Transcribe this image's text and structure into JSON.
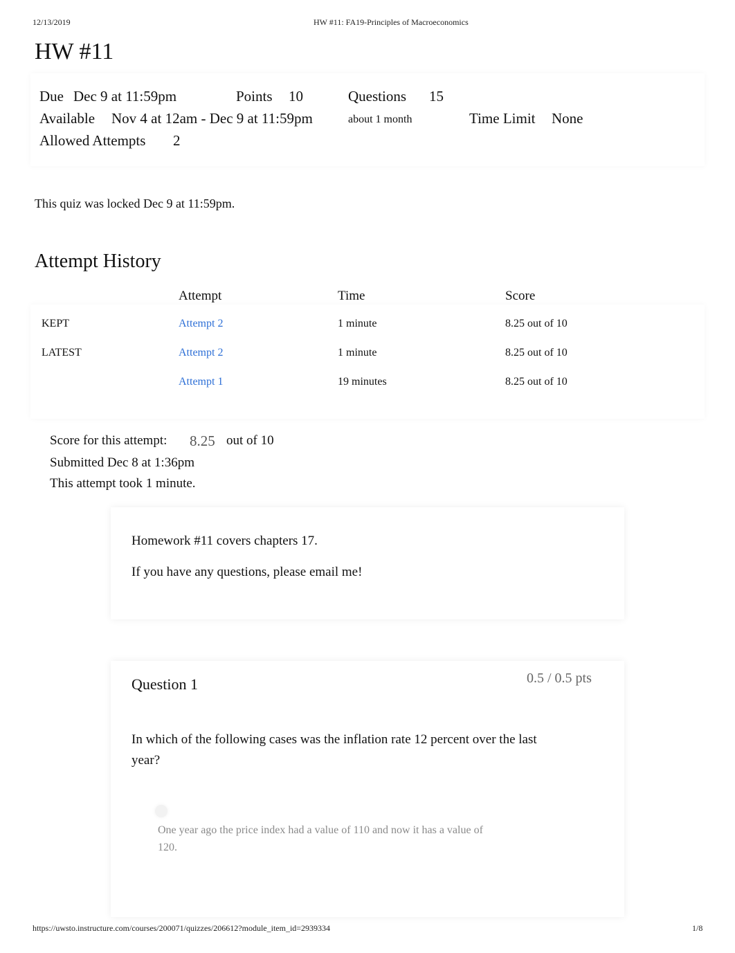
{
  "print_header": {
    "date": "12/13/2019",
    "title": "HW #11: FA19-Principles of Macroeconomics"
  },
  "page_title": "HW #11",
  "quiz_meta": {
    "due_label": "Due",
    "due_value": "Dec 9 at 11:59pm",
    "points_label": "Points",
    "points_value": "10",
    "questions_label": "Questions",
    "questions_value": "15",
    "available_label": "Available",
    "available_value": "Nov 4 at 12am - Dec 9 at 11:59pm",
    "available_duration": "about 1 month",
    "time_limit_label": "Time Limit",
    "time_limit_value": "None",
    "allowed_attempts_label": "Allowed Attempts",
    "allowed_attempts_value": "2"
  },
  "locked_notice": "This quiz was locked Dec 9 at 11:59pm.",
  "attempt_history": {
    "heading": "Attempt History",
    "columns": [
      "",
      "Attempt",
      "Time",
      "Score"
    ],
    "rows": [
      {
        "tag": "KEPT",
        "attempt": "Attempt 2",
        "time": "1 minute",
        "score": "8.25 out of 10"
      },
      {
        "tag": "LATEST",
        "attempt": "Attempt 2",
        "time": "1 minute",
        "score": "8.25 out of 10"
      },
      {
        "tag": "",
        "attempt": "Attempt 1",
        "time": "19 minutes",
        "score": "8.25 out of 10"
      }
    ]
  },
  "attempt_summary": {
    "score_label": "Score for this attempt:",
    "score_value": "8.25",
    "score_total": "out of 10",
    "submitted": "Submitted Dec 8 at 1:36pm",
    "duration": "This attempt took 1 minute."
  },
  "instructions": {
    "line1": "Homework #11 covers chapters 17.",
    "line2": "If you have any questions, please email me!"
  },
  "question1": {
    "title": "Question 1",
    "points": "0.5 / 0.5 pts",
    "prompt_line1": "In which of the following cases was the inflation rate 12 percent over the last",
    "prompt_line2": "year?",
    "answer_line1": "One year ago the price index had a value of 110 and now it has a value of",
    "answer_line2": "120."
  },
  "print_footer": {
    "url": "https://uwsto.instructure.com/courses/200071/quizzes/206612?module_item_id=2939334",
    "page": "1/8"
  }
}
